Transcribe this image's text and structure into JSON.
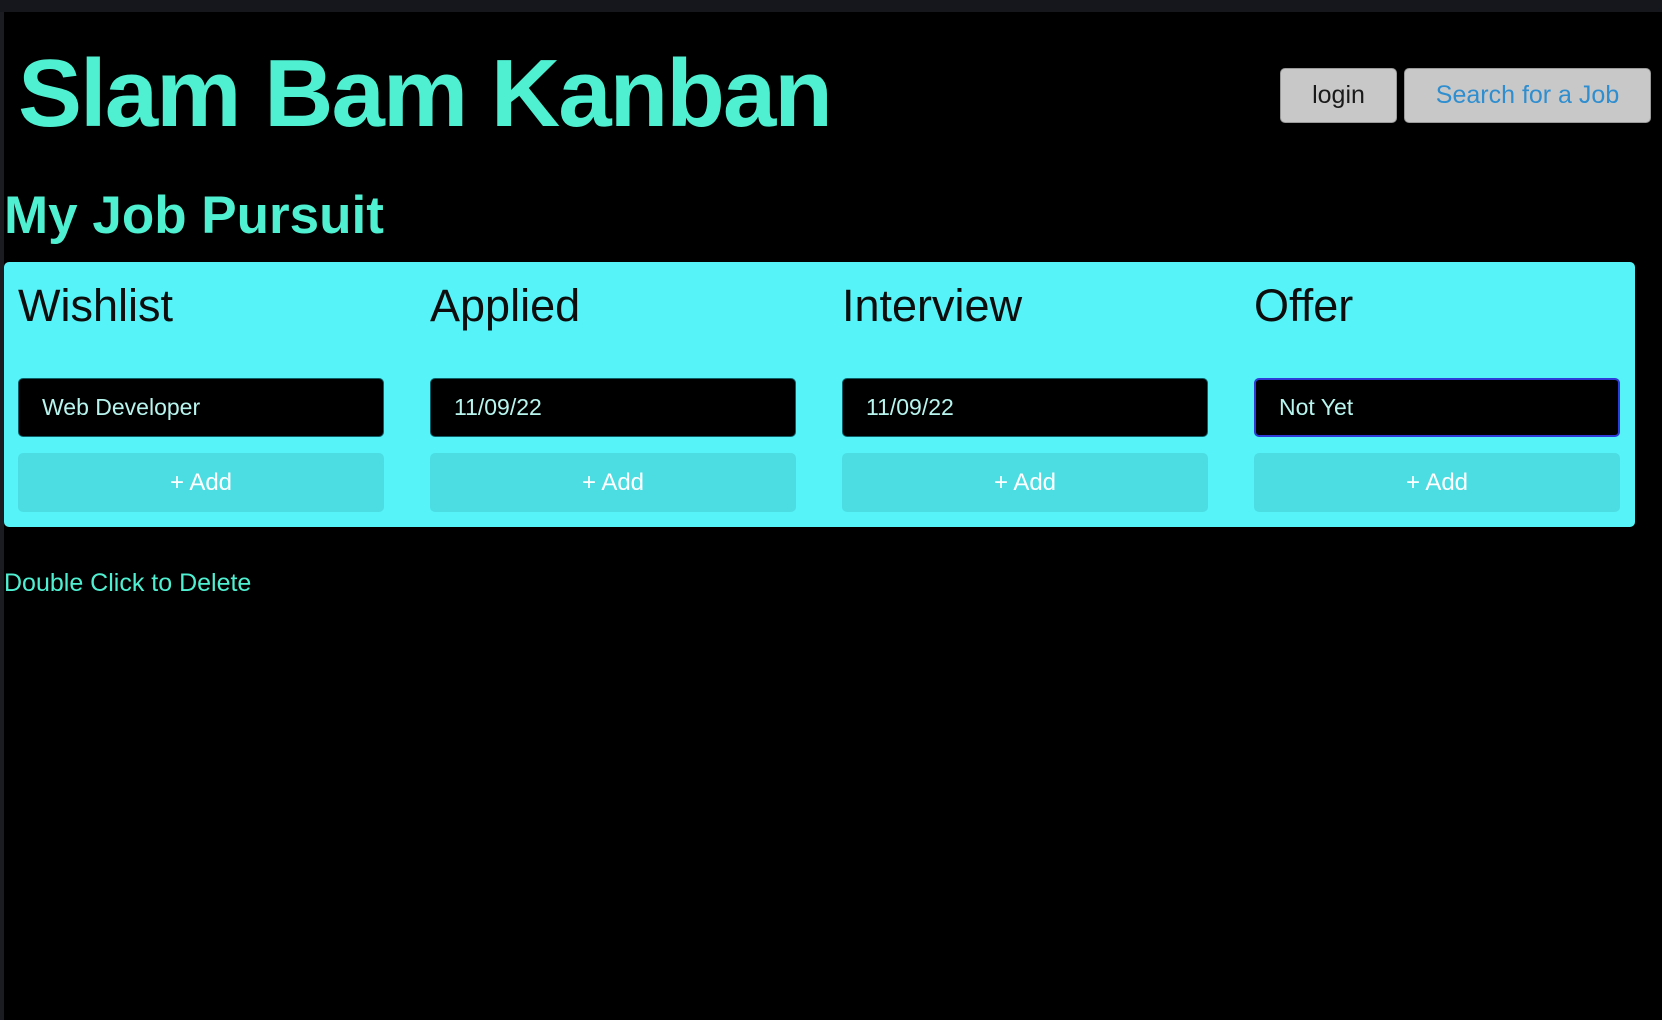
{
  "header": {
    "title": "Slam Bam Kanban",
    "login_label": "login",
    "search_label": "Search for a Job"
  },
  "main": {
    "title": "My Job Pursuit",
    "hint": "Double Click to Delete"
  },
  "board": {
    "columns": [
      {
        "title": "Wishlist",
        "value": "Web Developer",
        "add_label": "+ Add"
      },
      {
        "title": "Applied",
        "value": "11/09/22",
        "add_label": "+ Add"
      },
      {
        "title": "Interview",
        "value": "11/09/22",
        "add_label": "+ Add"
      },
      {
        "title": "Offer",
        "value": "Not Yet",
        "add_label": "+ Add"
      }
    ]
  },
  "colors": {
    "accent": "#4ff0d2",
    "board_bg": "#56f4f8",
    "add_button_bg": "#4cdde3",
    "input_text": "#b8f5ef",
    "page_bg": "#000000"
  }
}
